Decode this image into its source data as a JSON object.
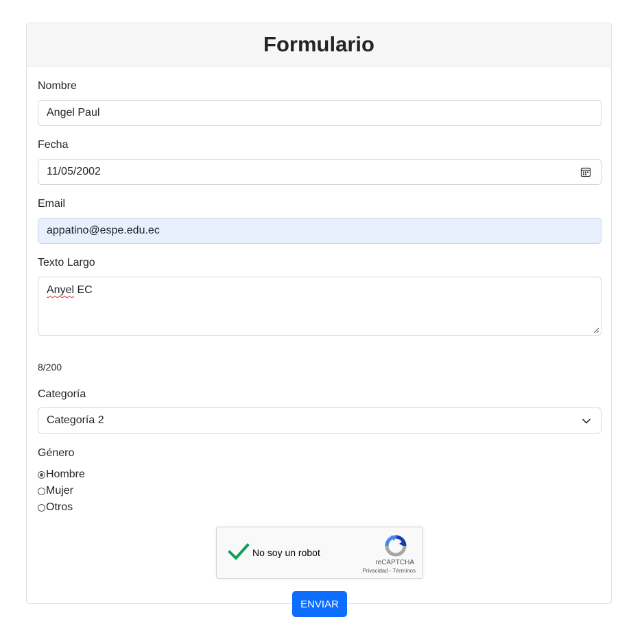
{
  "form": {
    "title": "Formulario",
    "nombre": {
      "label": "Nombre",
      "value": "Angel Paul"
    },
    "fecha": {
      "label": "Fecha",
      "value": "11/05/2002"
    },
    "email": {
      "label": "Email",
      "value": "appatino@espe.edu.ec"
    },
    "texto": {
      "label": "Texto Largo",
      "value_misspelled": "Anyel",
      "value_rest": " EC",
      "counter": "8/200"
    },
    "categoria": {
      "label": "Categoría",
      "selected": "Categoría 2"
    },
    "genero": {
      "label": "Género",
      "options": [
        "Hombre",
        "Mujer",
        "Otros"
      ],
      "selected": "Hombre"
    },
    "captcha": {
      "text": "No soy un robot",
      "brand": "reCAPTCHA",
      "links": "Privacidad - Términos"
    },
    "submit_label": "ENVIAR"
  },
  "icons": {
    "date": "calendar-icon",
    "select": "chevron-down-icon",
    "resize": "resize-handle-icon",
    "captcha_check": "checkmark-icon",
    "captcha_logo": "recaptcha-logo-icon"
  },
  "colors": {
    "primary": "#0d6efd",
    "autofill": "#e8f0fe",
    "check": "#0f9d58"
  }
}
